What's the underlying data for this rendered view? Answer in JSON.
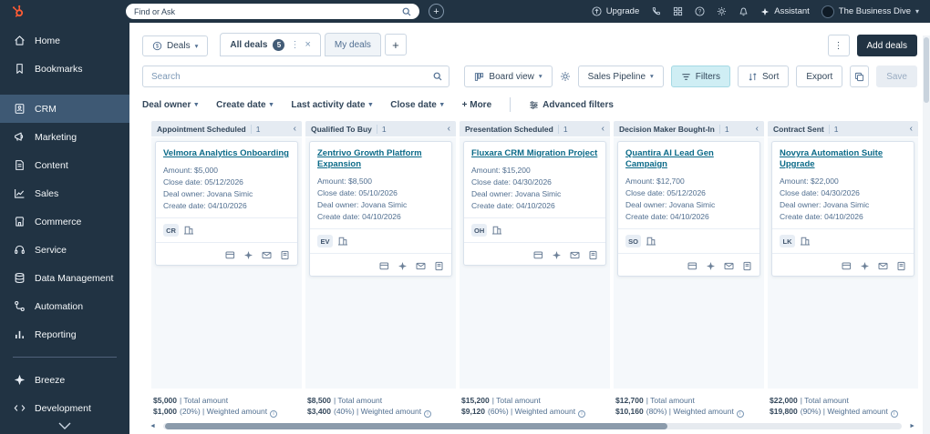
{
  "topbar": {
    "search_placeholder": "Find or Ask",
    "upgrade_label": "Upgrade",
    "assistant_label": "Assistant",
    "account_name": "The Business Dive"
  },
  "sidebar": {
    "items": [
      {
        "label": "Home"
      },
      {
        "label": "Bookmarks"
      },
      {
        "label": "CRM"
      },
      {
        "label": "Marketing"
      },
      {
        "label": "Content"
      },
      {
        "label": "Sales"
      },
      {
        "label": "Commerce"
      },
      {
        "label": "Service"
      },
      {
        "label": "Data Management"
      },
      {
        "label": "Automation"
      },
      {
        "label": "Reporting"
      },
      {
        "label": "Breeze"
      },
      {
        "label": "Development"
      }
    ]
  },
  "header": {
    "object_button": "Deals",
    "tab_all": "All deals",
    "tab_all_count": "5",
    "tab_my": "My deals",
    "add_deals": "Add deals"
  },
  "toolbar": {
    "search_placeholder": "Search",
    "board_view": "Board view",
    "pipeline": "Sales Pipeline",
    "filters": "Filters",
    "sort": "Sort",
    "export": "Export",
    "save": "Save"
  },
  "filters_row": {
    "deal_owner": "Deal owner",
    "create_date": "Create date",
    "last_activity": "Last activity date",
    "close_date": "Close date",
    "more": "+ More",
    "advanced": "Advanced filters"
  },
  "board": {
    "columns": [
      {
        "name": "Appointment Scheduled",
        "count": "1",
        "card": {
          "title": "Velmora Analytics Onboarding",
          "amount": "Amount: $5,000",
          "close_date": "Close date: 05/12/2026",
          "owner": "Deal owner: Jovana Simic",
          "create_date": "Create date: 04/10/2026",
          "avatar": "CR"
        },
        "total_amount": "$5,000",
        "total_label": "| Total amount",
        "weighted_amount": "$1,000",
        "weighted_label": "(20%) | Weighted amount"
      },
      {
        "name": "Qualified To Buy",
        "count": "1",
        "card": {
          "title": "Zentrivo Growth Platform Expansion",
          "amount": "Amount: $8,500",
          "close_date": "Close date: 05/10/2026",
          "owner": "Deal owner: Jovana Simic",
          "create_date": "Create date: 04/10/2026",
          "avatar": "EV"
        },
        "total_amount": "$8,500",
        "total_label": "| Total amount",
        "weighted_amount": "$3,400",
        "weighted_label": "(40%) | Weighted amount"
      },
      {
        "name": "Presentation Scheduled",
        "count": "1",
        "card": {
          "title": "Fluxara CRM Migration Project",
          "amount": "Amount: $15,200",
          "close_date": "Close date: 04/30/2026",
          "owner": "Deal owner: Jovana Simic",
          "create_date": "Create date: 04/10/2026",
          "avatar": "OH"
        },
        "total_amount": "$15,200",
        "total_label": "| Total amount",
        "weighted_amount": "$9,120",
        "weighted_label": "(60%) | Weighted amount"
      },
      {
        "name": "Decision Maker Bought-In",
        "count": "1",
        "card": {
          "title": "Quantira AI Lead Gen Campaign",
          "amount": "Amount: $12,700",
          "close_date": "Close date: 05/12/2026",
          "owner": "Deal owner: Jovana Simic",
          "create_date": "Create date: 04/10/2026",
          "avatar": "SO"
        },
        "total_amount": "$12,700",
        "total_label": "| Total amount",
        "weighted_amount": "$10,160",
        "weighted_label": "(80%) | Weighted amount"
      },
      {
        "name": "Contract Sent",
        "count": "1",
        "card": {
          "title": "Novyra Automation Suite Upgrade",
          "amount": "Amount: $22,000",
          "close_date": "Close date: 04/30/2026",
          "owner": "Deal owner: Jovana Simic",
          "create_date": "Create date: 04/10/2026",
          "avatar": "LK"
        },
        "total_amount": "$22,000",
        "total_label": "| Total amount",
        "weighted_amount": "$19,800",
        "weighted_label": "(90%) | Weighted amount"
      }
    ]
  },
  "icons": {
    "caret_down": "▾",
    "kebab": "⋮",
    "close": "×",
    "plus": "+",
    "collapse_left": "‹",
    "arrow_left": "◄",
    "arrow_right": "►",
    "info": "i",
    "more_plus": "+"
  },
  "colors": {
    "brand_accent": "#ff5c35",
    "topbar_bg": "#213343",
    "link": "#0b6a88",
    "filters_active_bg": "#cfeef4"
  }
}
